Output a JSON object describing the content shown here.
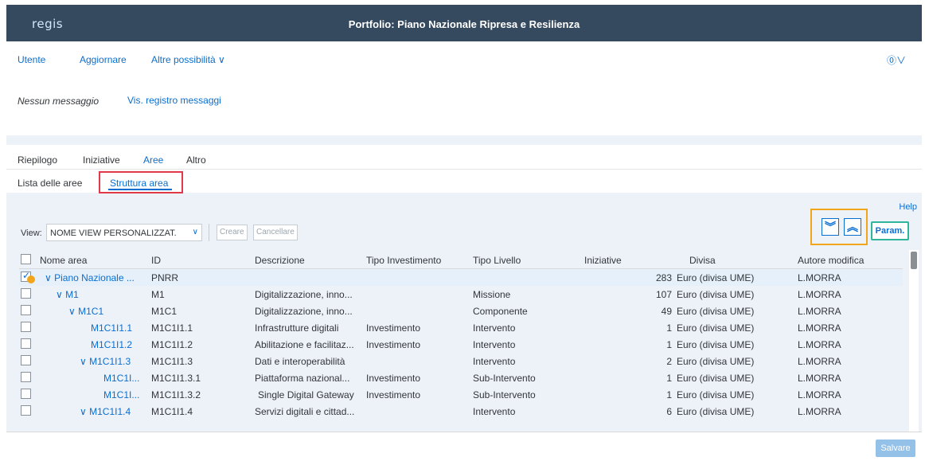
{
  "shell": {
    "logo": "regis",
    "title": "Portfolio: Piano Nazionale Ripresa e Resilienza"
  },
  "toolbar": {
    "utente": "Utente",
    "aggiornare": "Aggiornare",
    "altre": "Altre possibilità ∨",
    "help_menu": "⓪∨"
  },
  "messages": {
    "none": "Nessun messaggio",
    "log_link": "Vis. registro messaggi"
  },
  "tabs": [
    "Riepilogo",
    "Iniziative",
    "Aree",
    "Altro"
  ],
  "subtabs": {
    "list": "Lista delle aree",
    "structure": "Struttura area"
  },
  "panel": {
    "help": "Help",
    "view_label": "View:",
    "view_value": "NOME VIEW PERSONALIZZAT.",
    "create": "Creare",
    "delete": "Cancellare",
    "param": "Param.",
    "expand_icon": "⌄⌄",
    "collapse_icon": "⌃⌃"
  },
  "table": {
    "headers": [
      "Nome area",
      "ID",
      "Descrizione",
      "Tipo Investimento",
      "Tipo Livello",
      "Iniziative",
      "Divisa",
      "Autore modifica"
    ],
    "rows": [
      {
        "name": "∨ Piano Nazionale ...",
        "id": "PNRR",
        "desc": "",
        "tipo_inv": "",
        "livello": "",
        "iniz": "283",
        "divisa": "Euro (divisa UME)",
        "autore": "L.MORRA"
      },
      {
        "name": "∨ M1",
        "id": "M1",
        "desc": "Digitalizzazione, inno...",
        "tipo_inv": "",
        "livello": "Missione",
        "iniz": "107",
        "divisa": "Euro (divisa UME)",
        "autore": "L.MORRA"
      },
      {
        "name": "∨ M1C1",
        "id": "M1C1",
        "desc": "Digitalizzazione, inno...",
        "tipo_inv": "",
        "livello": "Componente",
        "iniz": "49",
        "divisa": "Euro (divisa UME)",
        "autore": "L.MORRA"
      },
      {
        "name": "M1C1I1.1",
        "id": "M1C1I1.1",
        "desc": "Infrastrutture digitali",
        "tipo_inv": "Investimento",
        "livello": "Intervento",
        "iniz": "1",
        "divisa": "Euro (divisa UME)",
        "autore": "L.MORRA"
      },
      {
        "name": "M1C1I1.2",
        "id": "M1C1I1.2",
        "desc": "Abilitazione e facilitaz...",
        "tipo_inv": "Investimento",
        "livello": "Intervento",
        "iniz": "1",
        "divisa": "Euro (divisa UME)",
        "autore": "L.MORRA"
      },
      {
        "name": "∨ M1C1I1.3",
        "id": "M1C1I1.3",
        "desc": "Dati e interoperabilità",
        "tipo_inv": "",
        "livello": "Intervento",
        "iniz": "2",
        "divisa": "Euro (divisa UME)",
        "autore": "L.MORRA"
      },
      {
        "name": "M1C1I...",
        "id": "M1C1I1.3.1",
        "desc": "Piattaforma nazional...",
        "tipo_inv": "Investimento",
        "livello": "Sub-Intervento",
        "iniz": "1",
        "divisa": "Euro (divisa UME)",
        "autore": "L.MORRA"
      },
      {
        "name": "M1C1I...",
        "id": "M1C1I1.3.2",
        "desc": "Single Digital Gateway",
        "tipo_inv": "Investimento",
        "livello": "Sub-Intervento",
        "iniz": "1",
        "divisa": "Euro (divisa UME)",
        "autore": "L.MORRA"
      },
      {
        "name": "∨ M1C1I1.4",
        "id": "M1C1I1.4",
        "desc": "Servizi digitali e cittad...",
        "tipo_inv": "",
        "livello": "Intervento",
        "iniz": "6",
        "divisa": "Euro (divisa UME)",
        "autore": "L.MORRA"
      }
    ]
  },
  "footer": {
    "save": "Salvare"
  }
}
